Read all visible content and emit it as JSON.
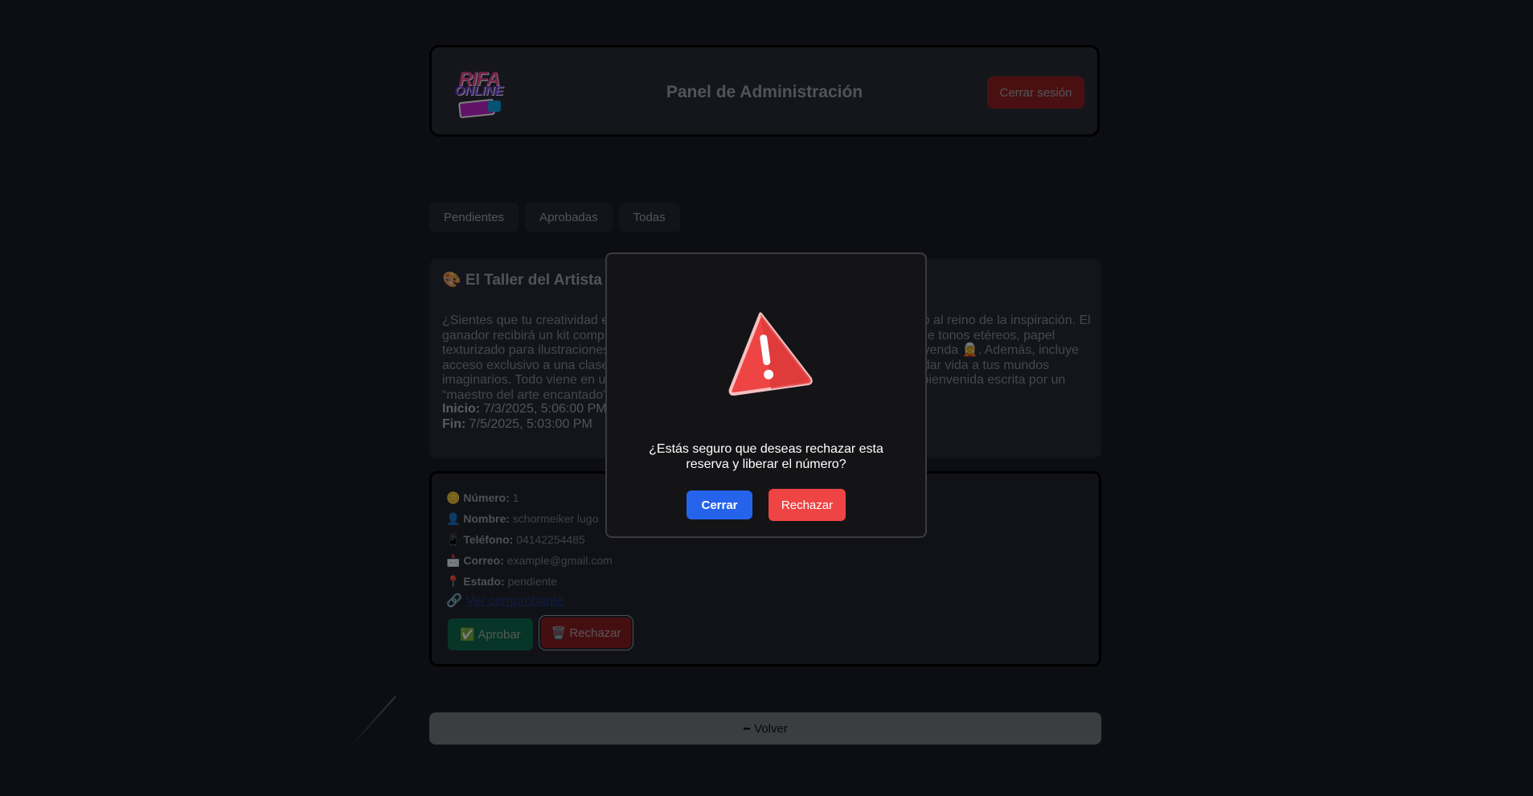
{
  "header": {
    "logo": {
      "line1": "RIFA",
      "line2": "ONLINE"
    },
    "title": "Panel de Administración",
    "logout_label": "Cerrar sesión"
  },
  "tabs": [
    {
      "label": "Pendientes"
    },
    {
      "label": "Aprobadas"
    },
    {
      "label": "Todas"
    }
  ],
  "raffle": {
    "title": "🎨 El Taller del Artista Encantado 🖌️",
    "description": "¿Sientes que tu creatividad está atrapada en otro plano? Esta rifa es un portal directo al reino de la inspiración. El ganador recibirá un kit completo de arte fantástico: plumas de punta fina, acuarelas de tonos etéreos, papel texturizado para ilustraciones mágicas y una guía ilustrada para crear criaturas de leyenda 🧝. Además, incluye acceso exclusivo a una clase virtual con un ilustrador profesional que te enseñará a dar vida a tus mundos imaginarios. Todo viene en una caja decorada con símbolos arcanos y una carta de bienvenida escrita por un “maestro del arte encantado” ✨.",
    "start_label": "Inicio:",
    "start_value": "7/3/2025, 5:06:00 PM",
    "end_label": "Fin:",
    "end_value": "7/5/2025, 5:03:00 PM"
  },
  "reservation": {
    "numero_icon": "🪙",
    "numero_label": "Número:",
    "numero_value": "1",
    "nombre_icon": "👤",
    "nombre_label": "Nombre:",
    "nombre_value": "schormeiker lugo",
    "telefono_icon": "📱",
    "telefono_label": "Teléfono:",
    "telefono_value": "04142254485",
    "correo_icon": "📩",
    "correo_label": "Correo:",
    "correo_value": "example@gmail.com",
    "estado_icon": "📍",
    "estado_label": "Estado:",
    "estado_value": "pendiente",
    "link_icon": "🔗",
    "link_label": "Ver comprobante",
    "approve_label": "✅ Aprobar",
    "reject_label": "🗑️ Rechazar"
  },
  "back_label": "Volver",
  "back_icon": "minus-icon",
  "modal": {
    "icon": "warning-icon",
    "message": "¿Estás seguro que deseas rechazar esta reserva y liberar el número?",
    "close_label": "Cerrar",
    "reject_label": "Rechazar"
  },
  "colors": {
    "background": "#1a1d29",
    "primary": "#2563eb",
    "danger": "#ef4444",
    "success": "#0f6b4e"
  }
}
